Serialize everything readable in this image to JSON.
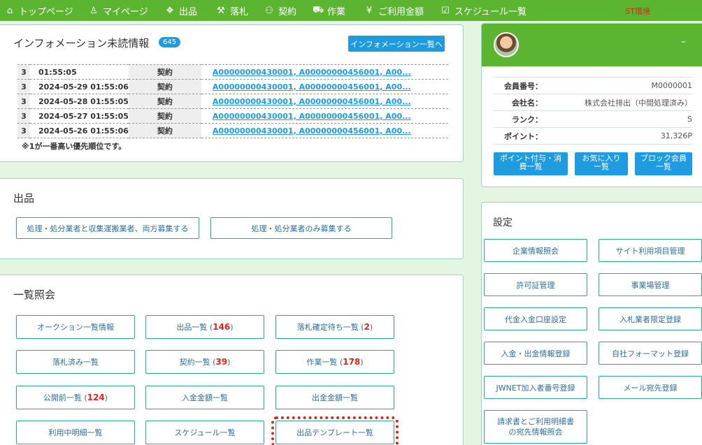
{
  "nav": {
    "items": [
      {
        "icon": "home-icon",
        "glyph": "⌂",
        "label": "トップページ"
      },
      {
        "icon": "person-icon",
        "glyph": "♙",
        "label": "マイページ"
      },
      {
        "icon": "boxes-icon",
        "glyph": "❖",
        "label": "出品"
      },
      {
        "icon": "gavel-icon",
        "glyph": "⚒",
        "label": "落札"
      },
      {
        "icon": "people-icon",
        "glyph": "⚇",
        "label": "契約"
      },
      {
        "icon": "truck-icon",
        "glyph": "⛟",
        "label": "作業"
      },
      {
        "icon": "yen-icon",
        "glyph": "¥",
        "label": "ご利用金額"
      },
      {
        "icon": "calendar-check-icon",
        "glyph": "☑",
        "label": "スケジュール一覧"
      }
    ],
    "env_label": "ST環境"
  },
  "info": {
    "title": "インフォメーション未読情報",
    "badge": "645",
    "list_button": "インフォメーション一覧へ",
    "rows": [
      {
        "priority": "3",
        "date": "01:55:05",
        "type": "契約",
        "link": "A00000000430001, A00000000456001, A00..."
      },
      {
        "priority": "3",
        "date": "2024-05-29 01:55:06",
        "type": "契約",
        "link": "A00000000430001, A00000000456001, A00..."
      },
      {
        "priority": "3",
        "date": "2024-05-28 01:55:05",
        "type": "契約",
        "link": "A00000000430001, A00000000456001, A00..."
      },
      {
        "priority": "3",
        "date": "2024-05-27 01:55:05",
        "type": "契約",
        "link": "A00000000430001, A00000000456001, A00..."
      },
      {
        "priority": "3",
        "date": "2024-05-26 01:55:06",
        "type": "契約",
        "link": "A00000000430001, A00000000456001, A00..."
      }
    ],
    "note": "※1が一番高い優先順位です。"
  },
  "listing": {
    "title": "出品",
    "btn_both": "処理・処分業者と収集運搬業者、両方募集する",
    "btn_only": "処理・処分業者のみ募集する"
  },
  "query": {
    "title": "一覧照会",
    "auction": "オークション一覧情報",
    "listing_label": "出品一覧 (",
    "listing_count": "146",
    "listing_close": ")",
    "pending_label": "落札確定待ち一覧 (",
    "pending_count": "2",
    "pending_close": ")",
    "won": "落札済み一覧",
    "contract_label": "契約一覧 (",
    "contract_count": "39",
    "contract_close": ")",
    "work_label": "作業一覧 (",
    "work_count": "178",
    "work_close": ")",
    "prepub_label": "公開前一覧 (",
    "prepub_count": "124",
    "prepub_close": ")",
    "deposit": "入金金額一覧",
    "payout": "出金金額一覧",
    "usage": "利用中明細一覧",
    "schedule": "スケジュール一覧",
    "template": "出品テンプレート一覧"
  },
  "member": {
    "minimize": "–",
    "rows": [
      {
        "key": "会員番号：",
        "value": "M0000001"
      },
      {
        "key": "会社名：",
        "value": "株式会社排出（中間処理済み）"
      },
      {
        "key": "ランク：",
        "value": "S"
      },
      {
        "key": "ポイント：",
        "value": "31,326P"
      }
    ],
    "btn_points": "ポイント付与・消\n費一覧",
    "btn_fav": "お気に入り\n一覧",
    "btn_block": "ブロック会員\n一覧"
  },
  "settings": {
    "title": "設定",
    "company": "企業情報照会",
    "site_items": "サイト利用項目管理",
    "permit": "許可証管理",
    "site": "事業場管理",
    "bank": "代金入金口座設定",
    "bidder": "入札業者限定登録",
    "io_register": "入金・出金情報登録",
    "format": "自社フォーマット登録",
    "jwnet": "JWNET加入者番号登録",
    "mail": "メール宛先登録",
    "invoice": "請求書とご利用明細書\nの宛先情報照会"
  }
}
